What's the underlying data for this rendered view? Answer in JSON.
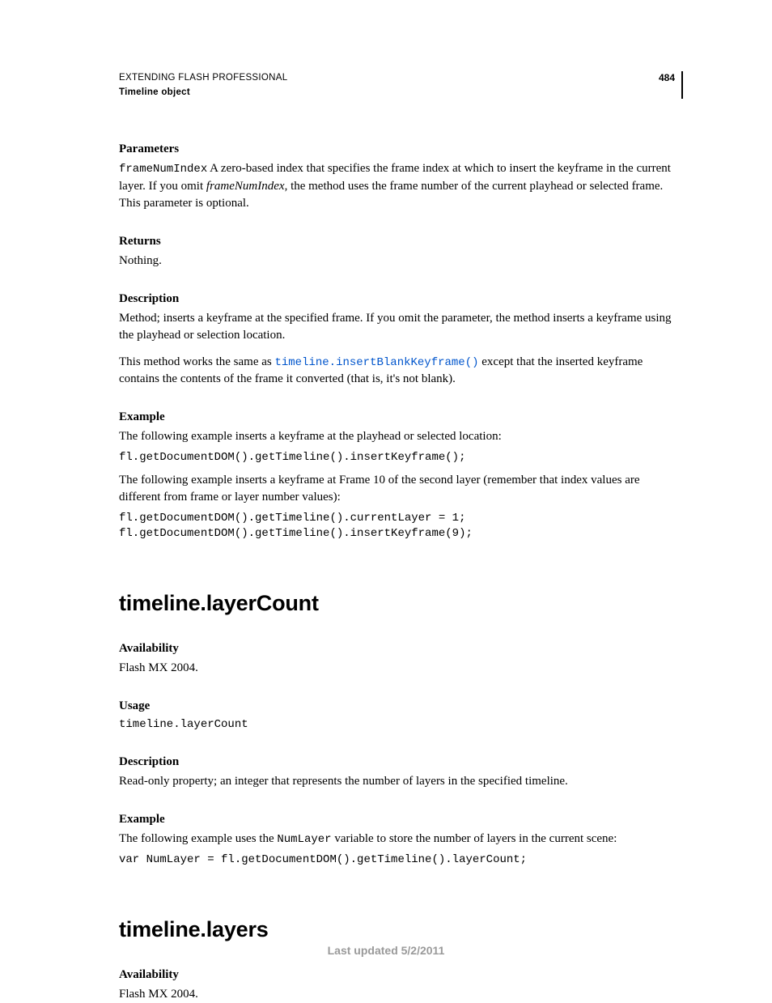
{
  "header": {
    "title": "EXTENDING FLASH PROFESSIONAL",
    "subtitle": "Timeline object",
    "page_number": "484"
  },
  "section1": {
    "parameters_h": "Parameters",
    "param_code": "frameNumIndex",
    "param_text_a": "  A zero-based index that specifies the frame index at which to insert the keyframe in the current layer. If you omit ",
    "param_italic": "frameNumIndex",
    "param_text_b": ", the method uses the frame number of the current playhead or selected frame. This parameter is optional.",
    "returns_h": "Returns",
    "returns_text": "Nothing.",
    "description_h": "Description",
    "description_text": "Method; inserts a keyframe at the specified frame. If you omit the parameter, the method inserts a keyframe using the playhead or selection location.",
    "desc2_a": "This method works the same as ",
    "desc2_link": "timeline.insertBlankKeyframe()",
    "desc2_b": " except that the inserted keyframe contains the contents of the frame it converted (that is, it's not blank).",
    "example_h": "Example",
    "example_intro1": "The following example inserts a keyframe at the playhead or selected location:",
    "example_code1": "fl.getDocumentDOM().getTimeline().insertKeyframe();",
    "example_intro2": "The following example inserts a keyframe at Frame 10 of the second layer (remember that index values are different from frame or layer number values):",
    "example_code2": "fl.getDocumentDOM().getTimeline().currentLayer = 1; \nfl.getDocumentDOM().getTimeline().insertKeyframe(9);"
  },
  "section2": {
    "title": "timeline.layerCount",
    "availability_h": "Availability",
    "availability_text": "Flash MX 2004.",
    "usage_h": "Usage",
    "usage_code": "timeline.layerCount",
    "description_h": "Description",
    "description_text": "Read-only property; an integer that represents the number of layers in the specified timeline.",
    "example_h": "Example",
    "example_intro_a": "The following example uses the ",
    "example_intro_code": "NumLayer",
    "example_intro_b": " variable to store the number of layers in the current scene:",
    "example_code": "var NumLayer = fl.getDocumentDOM().getTimeline().layerCount;"
  },
  "section3": {
    "title": "timeline.layers",
    "availability_h": "Availability",
    "availability_text": "Flash MX 2004."
  },
  "footer": {
    "text": "Last updated 5/2/2011"
  }
}
